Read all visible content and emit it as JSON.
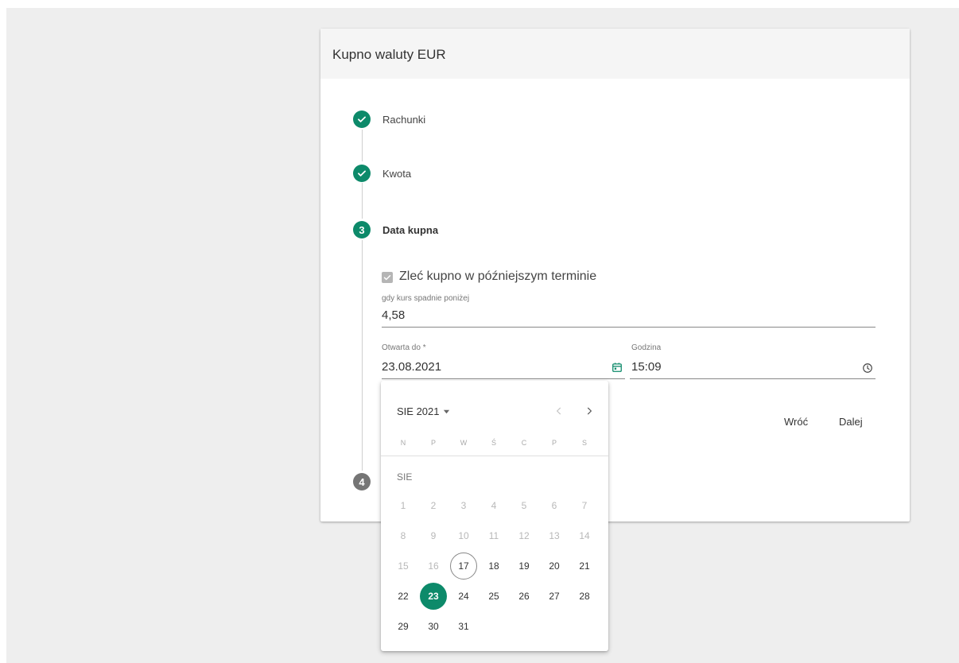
{
  "colors": {
    "accent": "#0d8a6a",
    "inactive_step": "#757575",
    "background": "#eeeeee"
  },
  "card": {
    "title": "Kupno waluty EUR"
  },
  "stepper": {
    "steps": [
      {
        "label": "Rachunki",
        "status": "completed",
        "icon": "check-icon"
      },
      {
        "label": "Kwota",
        "status": "completed",
        "icon": "check-icon"
      },
      {
        "label": "Data kupna",
        "status": "active",
        "number": "3"
      },
      {
        "label": "",
        "status": "pending",
        "number": "4"
      }
    ]
  },
  "form": {
    "checkbox": {
      "label": "Zleć kupno w późniejszym terminie",
      "checked": true
    },
    "rate": {
      "label": "gdy kurs spadnie poniżej",
      "value": "4,58"
    },
    "date": {
      "label": "Otwarta do *",
      "value": "23.08.2021",
      "icon": "calendar-icon"
    },
    "time": {
      "label": "Godzina",
      "value": "15:09",
      "icon": "clock-icon"
    },
    "back_label": "Wróć",
    "next_label": "Dalej"
  },
  "datepicker": {
    "month_year": "SIE 2021",
    "month_label": "SIE",
    "weekdays": [
      "N",
      "P",
      "W",
      "Ś",
      "C",
      "P",
      "S"
    ],
    "days": [
      {
        "d": "1",
        "state": "disabled"
      },
      {
        "d": "2",
        "state": "disabled"
      },
      {
        "d": "3",
        "state": "disabled"
      },
      {
        "d": "4",
        "state": "disabled"
      },
      {
        "d": "5",
        "state": "disabled"
      },
      {
        "d": "6",
        "state": "disabled"
      },
      {
        "d": "7",
        "state": "disabled"
      },
      {
        "d": "8",
        "state": "disabled"
      },
      {
        "d": "9",
        "state": "disabled"
      },
      {
        "d": "10",
        "state": "disabled"
      },
      {
        "d": "11",
        "state": "disabled"
      },
      {
        "d": "12",
        "state": "disabled"
      },
      {
        "d": "13",
        "state": "disabled"
      },
      {
        "d": "14",
        "state": "disabled"
      },
      {
        "d": "15",
        "state": "disabled"
      },
      {
        "d": "16",
        "state": "disabled"
      },
      {
        "d": "17",
        "state": "today"
      },
      {
        "d": "18",
        "state": "enabled"
      },
      {
        "d": "19",
        "state": "enabled"
      },
      {
        "d": "20",
        "state": "enabled"
      },
      {
        "d": "21",
        "state": "enabled"
      },
      {
        "d": "22",
        "state": "enabled"
      },
      {
        "d": "23",
        "state": "selected"
      },
      {
        "d": "24",
        "state": "enabled"
      },
      {
        "d": "25",
        "state": "enabled"
      },
      {
        "d": "26",
        "state": "enabled"
      },
      {
        "d": "27",
        "state": "enabled"
      },
      {
        "d": "28",
        "state": "enabled"
      },
      {
        "d": "29",
        "state": "enabled"
      },
      {
        "d": "30",
        "state": "enabled"
      },
      {
        "d": "31",
        "state": "enabled"
      }
    ]
  }
}
